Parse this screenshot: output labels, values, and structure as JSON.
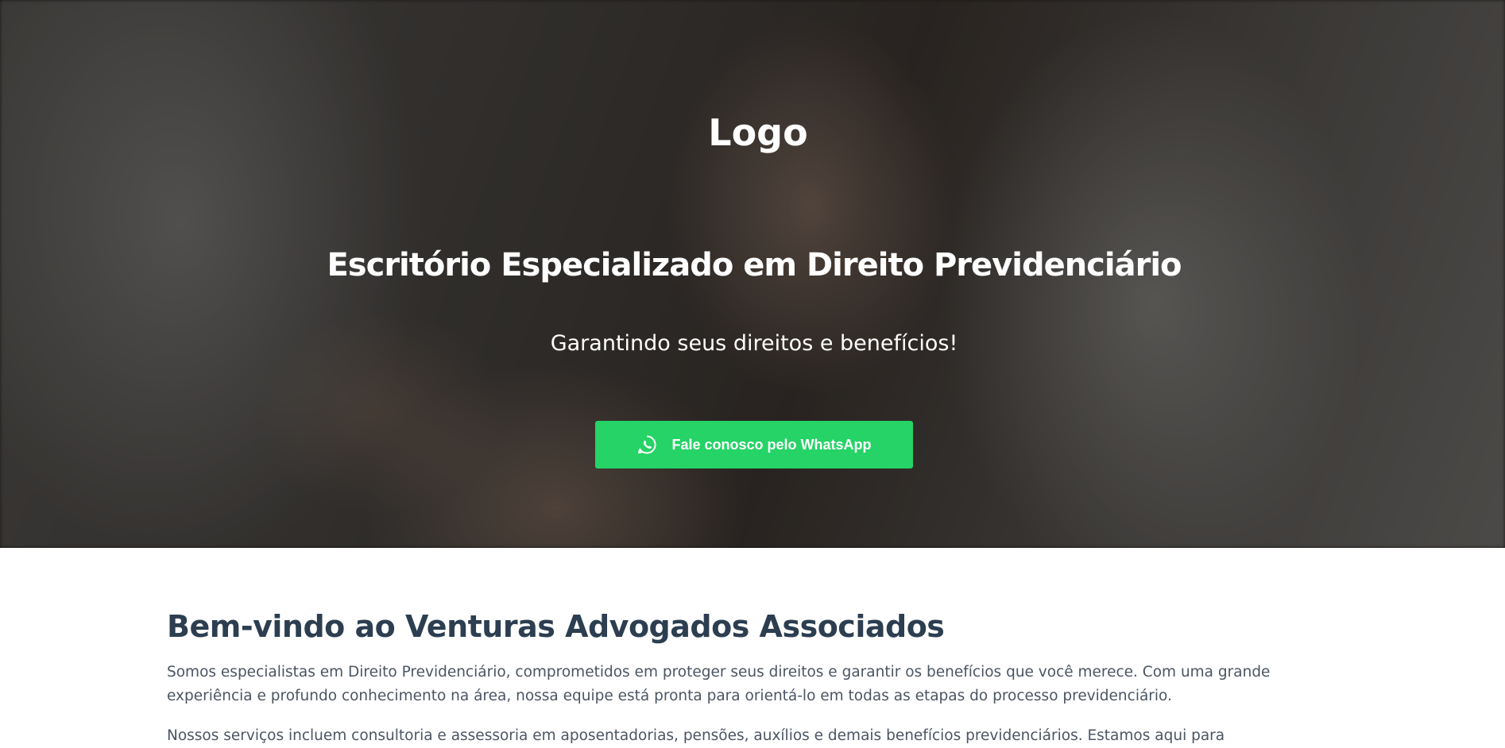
{
  "hero": {
    "logo": "Logo",
    "title": "Escritório Especializado em Direito Previdenciário",
    "subtitle": "Garantindo seus direitos e benefícios!",
    "cta": {
      "label": "Fale conosco pelo WhatsApp",
      "icon": "whatsapp-icon",
      "color": "#25d366"
    }
  },
  "about": {
    "title": "Bem-vindo ao Venturas Advogados Associados",
    "paragraphs": [
      "Somos especialistas em Direito Previdenciário, comprometidos em proteger seus direitos e garantir os benefícios que você merece. Com uma grande experiência e profundo conhecimento na área, nossa equipe está pronta para orientá-lo em todas as etapas do processo previdenciário.",
      "Nossos serviços incluem consultoria e assessoria em aposentadorias, pensões, auxílios e demais benefícios previdenciários. Estamos aqui para"
    ]
  },
  "colors": {
    "heading": "#2c3e50",
    "text": "#4b5563",
    "whatsapp": "#25d366"
  }
}
